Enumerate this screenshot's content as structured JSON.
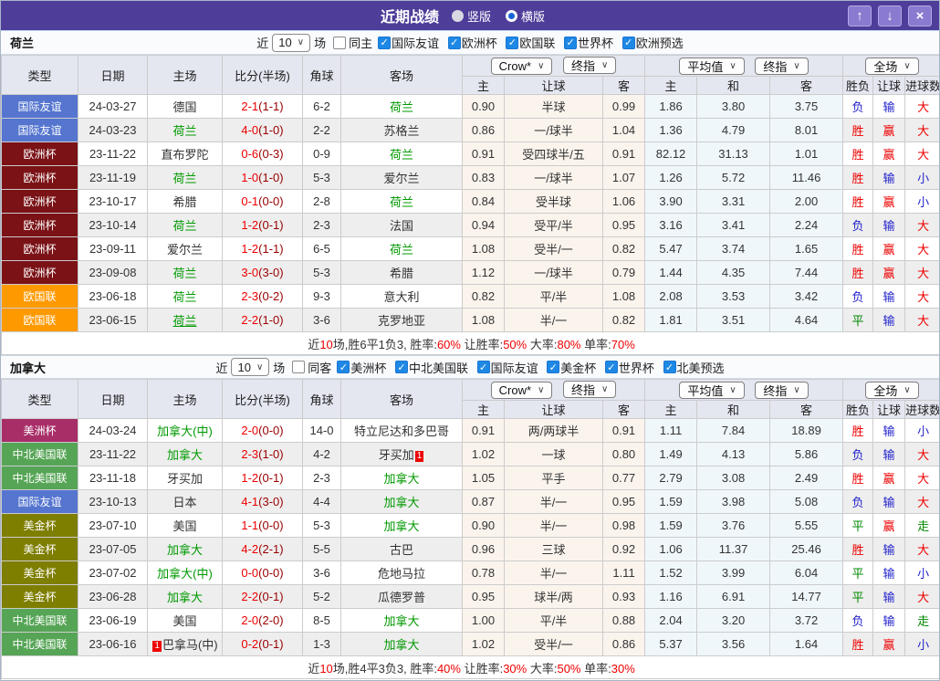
{
  "titlebar": {
    "title": "近期战绩",
    "radios": [
      {
        "label": "竖版",
        "selected": false
      },
      {
        "label": "横版",
        "selected": true
      }
    ],
    "up_icon": "↑",
    "down_icon": "↓",
    "close_icon": "×"
  },
  "colors": {
    "titlebar_bg": "#4e3d99",
    "accent_red": "#ee0000",
    "half_score": "#990000",
    "focus_team": "#009900",
    "checkbox_blue": "#1e88e5",
    "leagues": {
      "国际友谊": "#5575cf",
      "欧洲杯": "#7a1216",
      "欧国联": "#ff9900",
      "美洲杯": "#a82e68",
      "中北美国联": "#56a556",
      "美金杯": "#7e7e00"
    },
    "results": {
      "胜": "#ee0000",
      "平": "#008800",
      "负": "#2323cc",
      "赢": "#ee0000",
      "输": "#2323cc",
      "大": "#ee0000",
      "小": "#2323cc",
      "走": "#008800"
    }
  },
  "table_header": {
    "type": "类型",
    "date": "日期",
    "home": "主场",
    "score": "比分(半场)",
    "corner": "角球",
    "away": "客场",
    "odds_source": "Crow*",
    "odds_final": "终指",
    "avg_source": "平均值",
    "avg_final": "终指",
    "scope": "全场",
    "odds_home": "主",
    "odds_handicap": "让球",
    "odds_away": "客",
    "avg_home": "主",
    "avg_draw": "和",
    "avg_away": "客",
    "res_wdl": "胜负",
    "res_handicap": "让球",
    "res_goals": "进球数"
  },
  "sections": [
    {
      "team": "荷兰",
      "filter": {
        "near_label": "近",
        "count": "10",
        "field_label": "场",
        "same_label": "同主",
        "same_checked": false,
        "leagues": [
          "国际友谊",
          "欧洲杯",
          "欧国联",
          "世界杯",
          "欧洲预选"
        ]
      },
      "rows": [
        {
          "league": "国际友谊",
          "date": "24-03-27",
          "home": "德国",
          "away": "荷兰",
          "away_focus": true,
          "score": "2-1",
          "half": "(1-1)",
          "corner": "6-2",
          "odds": [
            "0.90",
            "半球",
            "0.99"
          ],
          "avg": [
            "1.86",
            "3.80",
            "3.75"
          ],
          "results": [
            "负",
            "输",
            "大"
          ]
        },
        {
          "league": "国际友谊",
          "date": "24-03-23",
          "home": "荷兰",
          "home_focus": true,
          "away": "苏格兰",
          "score": "4-0",
          "half": "(1-0)",
          "corner": "2-2",
          "odds": [
            "0.86",
            "一/球半",
            "1.04"
          ],
          "avg": [
            "1.36",
            "4.79",
            "8.01"
          ],
          "results": [
            "胜",
            "赢",
            "大"
          ]
        },
        {
          "league": "欧洲杯",
          "date": "23-11-22",
          "home": "直布罗陀",
          "away": "荷兰",
          "away_focus": true,
          "score": "0-6",
          "half": "(0-3)",
          "corner": "0-9",
          "odds": [
            "0.91",
            "受四球半/五",
            "0.91"
          ],
          "avg": [
            "82.12",
            "31.13",
            "1.01"
          ],
          "results": [
            "胜",
            "赢",
            "大"
          ]
        },
        {
          "league": "欧洲杯",
          "date": "23-11-19",
          "home": "荷兰",
          "home_focus": true,
          "away": "爱尔兰",
          "score": "1-0",
          "half": "(1-0)",
          "corner": "5-3",
          "odds": [
            "0.83",
            "一/球半",
            "1.07"
          ],
          "avg": [
            "1.26",
            "5.72",
            "11.46"
          ],
          "results": [
            "胜",
            "输",
            "小"
          ]
        },
        {
          "league": "欧洲杯",
          "date": "23-10-17",
          "home": "希腊",
          "away": "荷兰",
          "away_focus": true,
          "score": "0-1",
          "half": "(0-0)",
          "corner": "2-8",
          "odds": [
            "0.84",
            "受半球",
            "1.06"
          ],
          "avg": [
            "3.90",
            "3.31",
            "2.00"
          ],
          "results": [
            "胜",
            "赢",
            "小"
          ]
        },
        {
          "league": "欧洲杯",
          "date": "23-10-14",
          "home": "荷兰",
          "home_focus": true,
          "away": "法国",
          "score": "1-2",
          "half": "(0-1)",
          "corner": "2-3",
          "odds": [
            "0.94",
            "受平/半",
            "0.95"
          ],
          "avg": [
            "3.16",
            "3.41",
            "2.24"
          ],
          "results": [
            "负",
            "输",
            "大"
          ]
        },
        {
          "league": "欧洲杯",
          "date": "23-09-11",
          "home": "爱尔兰",
          "away": "荷兰",
          "away_focus": true,
          "score": "1-2",
          "half": "(1-1)",
          "corner": "6-5",
          "odds": [
            "1.08",
            "受半/一",
            "0.82"
          ],
          "avg": [
            "5.47",
            "3.74",
            "1.65"
          ],
          "results": [
            "胜",
            "赢",
            "大"
          ]
        },
        {
          "league": "欧洲杯",
          "date": "23-09-08",
          "home": "荷兰",
          "home_focus": true,
          "away": "希腊",
          "score": "3-0",
          "half": "(3-0)",
          "corner": "5-3",
          "odds": [
            "1.12",
            "一/球半",
            "0.79"
          ],
          "avg": [
            "1.44",
            "4.35",
            "7.44"
          ],
          "results": [
            "胜",
            "赢",
            "大"
          ]
        },
        {
          "league": "欧国联",
          "date": "23-06-18",
          "home": "荷兰",
          "home_focus": true,
          "away": "意大利",
          "score": "2-3",
          "half": "(0-2)",
          "corner": "9-3",
          "odds": [
            "0.82",
            "平/半",
            "1.08"
          ],
          "avg": [
            "2.08",
            "3.53",
            "3.42"
          ],
          "results": [
            "负",
            "输",
            "大"
          ]
        },
        {
          "league": "欧国联",
          "date": "23-06-15",
          "home": "荷兰",
          "home_focus": true,
          "home_underline": true,
          "away": "克罗地亚",
          "score": "2-2",
          "half": "(1-0)",
          "corner": "3-6",
          "odds": [
            "1.08",
            "半/一",
            "0.82"
          ],
          "avg": [
            "1.81",
            "3.51",
            "4.64"
          ],
          "results": [
            "平",
            "输",
            "大"
          ]
        }
      ],
      "summary": [
        {
          "text": "近",
          "red": false
        },
        {
          "text": "10",
          "red": true
        },
        {
          "text": "场,胜6平1负3, 胜率:",
          "red": false
        },
        {
          "text": "60%",
          "red": true
        },
        {
          "text": " 让胜率:",
          "red": false
        },
        {
          "text": "50%",
          "red": true
        },
        {
          "text": " 大率:",
          "red": false
        },
        {
          "text": "80%",
          "red": true
        },
        {
          "text": " 单率:",
          "red": false
        },
        {
          "text": "70%",
          "red": true
        }
      ]
    },
    {
      "team": "加拿大",
      "filter": {
        "near_label": "近",
        "count": "10",
        "field_label": "场",
        "same_label": "同客",
        "same_checked": false,
        "leagues": [
          "美洲杯",
          "中北美国联",
          "国际友谊",
          "美金杯",
          "世界杯",
          "北美预选"
        ]
      },
      "rows": [
        {
          "league": "美洲杯",
          "date": "24-03-24",
          "home": "加拿大(中)",
          "home_focus": true,
          "away": "特立尼达和多巴哥",
          "score": "2-0",
          "half": "(0-0)",
          "corner": "14-0",
          "odds": [
            "0.91",
            "两/两球半",
            "0.91"
          ],
          "avg": [
            "1.11",
            "7.84",
            "18.89"
          ],
          "results": [
            "胜",
            "输",
            "小"
          ]
        },
        {
          "league": "中北美国联",
          "date": "23-11-22",
          "home": "加拿大",
          "home_focus": true,
          "away": "牙买加",
          "away_badge": "1",
          "score": "2-3",
          "half": "(1-0)",
          "corner": "4-2",
          "odds": [
            "1.02",
            "一球",
            "0.80"
          ],
          "avg": [
            "1.49",
            "4.13",
            "5.86"
          ],
          "results": [
            "负",
            "输",
            "大"
          ]
        },
        {
          "league": "中北美国联",
          "date": "23-11-18",
          "home": "牙买加",
          "away": "加拿大",
          "away_focus": true,
          "score": "1-2",
          "half": "(0-1)",
          "corner": "2-3",
          "odds": [
            "1.05",
            "平手",
            "0.77"
          ],
          "avg": [
            "2.79",
            "3.08",
            "2.49"
          ],
          "results": [
            "胜",
            "赢",
            "大"
          ]
        },
        {
          "league": "国际友谊",
          "date": "23-10-13",
          "home": "日本",
          "away": "加拿大",
          "away_focus": true,
          "score": "4-1",
          "half": "(3-0)",
          "corner": "4-4",
          "odds": [
            "0.87",
            "半/一",
            "0.95"
          ],
          "avg": [
            "1.59",
            "3.98",
            "5.08"
          ],
          "results": [
            "负",
            "输",
            "大"
          ]
        },
        {
          "league": "美金杯",
          "date": "23-07-10",
          "home": "美国",
          "away": "加拿大",
          "away_focus": true,
          "score": "1-1",
          "half": "(0-0)",
          "corner": "5-3",
          "odds": [
            "0.90",
            "半/一",
            "0.98"
          ],
          "avg": [
            "1.59",
            "3.76",
            "5.55"
          ],
          "results": [
            "平",
            "赢",
            "走"
          ]
        },
        {
          "league": "美金杯",
          "date": "23-07-05",
          "home": "加拿大",
          "home_focus": true,
          "away": "古巴",
          "score": "4-2",
          "half": "(2-1)",
          "corner": "5-5",
          "odds": [
            "0.96",
            "三球",
            "0.92"
          ],
          "avg": [
            "1.06",
            "11.37",
            "25.46"
          ],
          "results": [
            "胜",
            "输",
            "大"
          ]
        },
        {
          "league": "美金杯",
          "date": "23-07-02",
          "home": "加拿大(中)",
          "home_focus": true,
          "away": "危地马拉",
          "score": "0-0",
          "half": "(0-0)",
          "corner": "3-6",
          "odds": [
            "0.78",
            "半/一",
            "1.11"
          ],
          "avg": [
            "1.52",
            "3.99",
            "6.04"
          ],
          "results": [
            "平",
            "输",
            "小"
          ]
        },
        {
          "league": "美金杯",
          "date": "23-06-28",
          "home": "加拿大",
          "home_focus": true,
          "away": "瓜德罗普",
          "score": "2-2",
          "half": "(0-1)",
          "corner": "5-2",
          "odds": [
            "0.95",
            "球半/两",
            "0.93"
          ],
          "avg": [
            "1.16",
            "6.91",
            "14.77"
          ],
          "results": [
            "平",
            "输",
            "大"
          ]
        },
        {
          "league": "中北美国联",
          "date": "23-06-19",
          "home": "美国",
          "away": "加拿大",
          "away_focus": true,
          "score": "2-0",
          "half": "(2-0)",
          "corner": "8-5",
          "odds": [
            "1.00",
            "平/半",
            "0.88"
          ],
          "avg": [
            "2.04",
            "3.20",
            "3.72"
          ],
          "results": [
            "负",
            "输",
            "走"
          ]
        },
        {
          "league": "中北美国联",
          "date": "23-06-16",
          "home": "巴拿马(中)",
          "home_badge": "1",
          "away": "加拿大",
          "away_focus": true,
          "score": "0-2",
          "half": "(0-1)",
          "corner": "1-3",
          "odds": [
            "1.02",
            "受半/一",
            "0.86"
          ],
          "avg": [
            "5.37",
            "3.56",
            "1.64"
          ],
          "results": [
            "胜",
            "赢",
            "小"
          ]
        }
      ],
      "summary": [
        {
          "text": "近",
          "red": false
        },
        {
          "text": "10",
          "red": true
        },
        {
          "text": "场,胜4平3负3, 胜率:",
          "red": false
        },
        {
          "text": "40%",
          "red": true
        },
        {
          "text": " 让胜率:",
          "red": false
        },
        {
          "text": "30%",
          "red": true
        },
        {
          "text": " 大率:",
          "red": false
        },
        {
          "text": "50%",
          "red": true
        },
        {
          "text": " 单率:",
          "red": false
        },
        {
          "text": "30%",
          "red": true
        }
      ]
    }
  ]
}
